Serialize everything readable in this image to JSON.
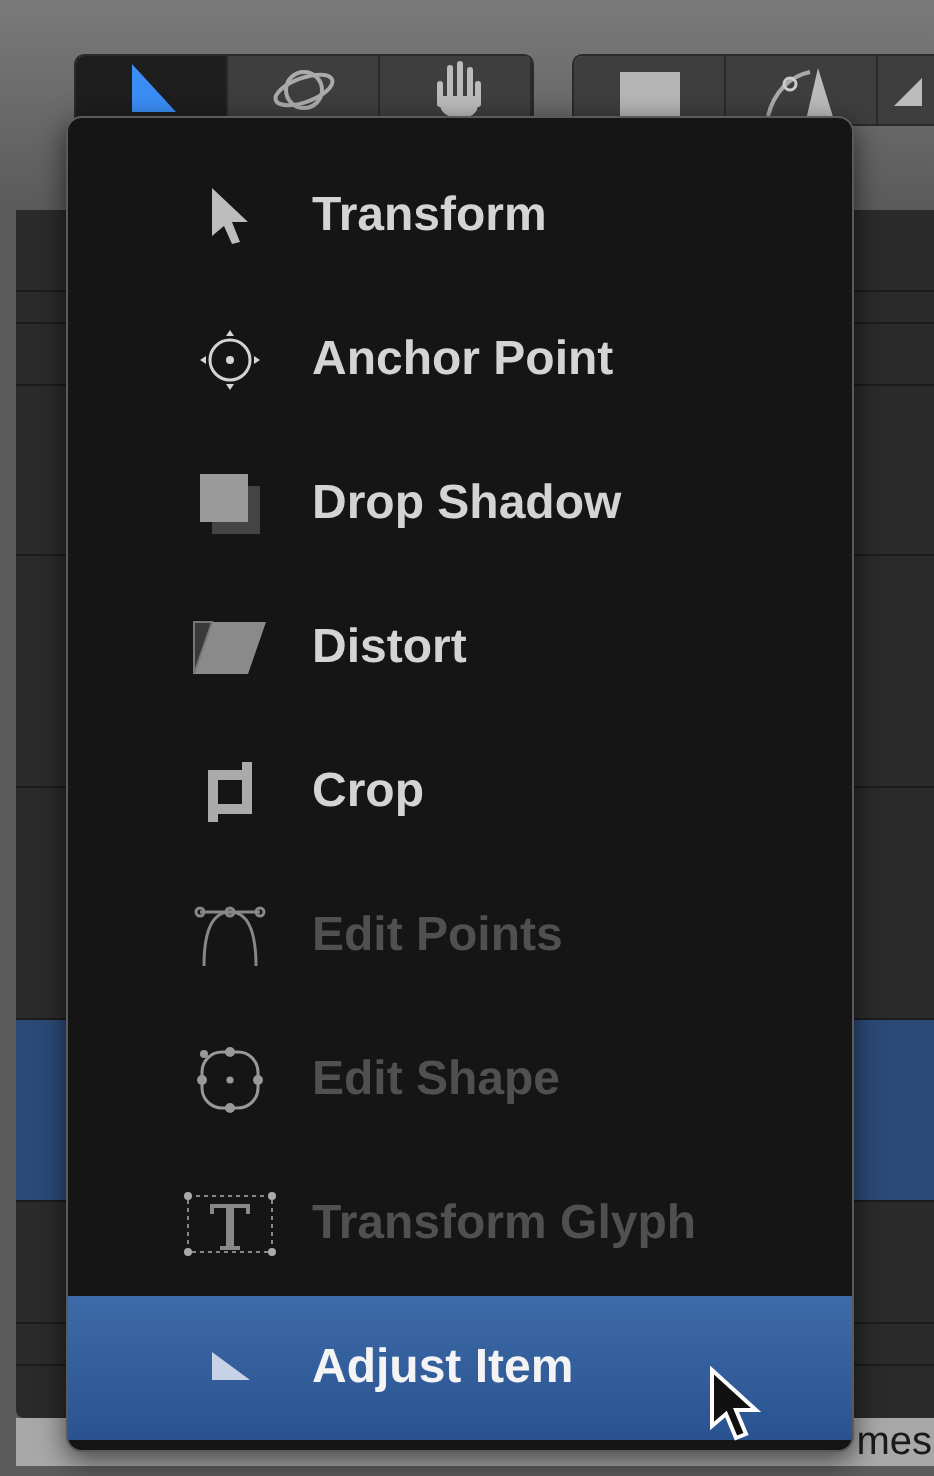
{
  "toolbar": {
    "groups": [
      {
        "tools": [
          {
            "selected": true
          },
          {
            "selected": false
          },
          {
            "selected": false
          }
        ]
      },
      {
        "tools": [
          {
            "selected": false
          },
          {
            "selected": false
          },
          {
            "selected": false
          }
        ]
      }
    ]
  },
  "menu": {
    "items": [
      {
        "label": "Transform",
        "disabled": false,
        "selected": false
      },
      {
        "label": "Anchor Point",
        "disabled": false,
        "selected": false
      },
      {
        "label": "Drop Shadow",
        "disabled": false,
        "selected": false
      },
      {
        "label": "Distort",
        "disabled": false,
        "selected": false
      },
      {
        "label": "Crop",
        "disabled": false,
        "selected": false
      },
      {
        "label": "Edit Points",
        "disabled": true,
        "selected": false
      },
      {
        "label": "Edit Shape",
        "disabled": true,
        "selected": false
      },
      {
        "label": "Transform Glyph",
        "disabled": true,
        "selected": false
      },
      {
        "label": "Adjust Item",
        "disabled": false,
        "selected": true
      }
    ]
  },
  "status_text": "mes"
}
